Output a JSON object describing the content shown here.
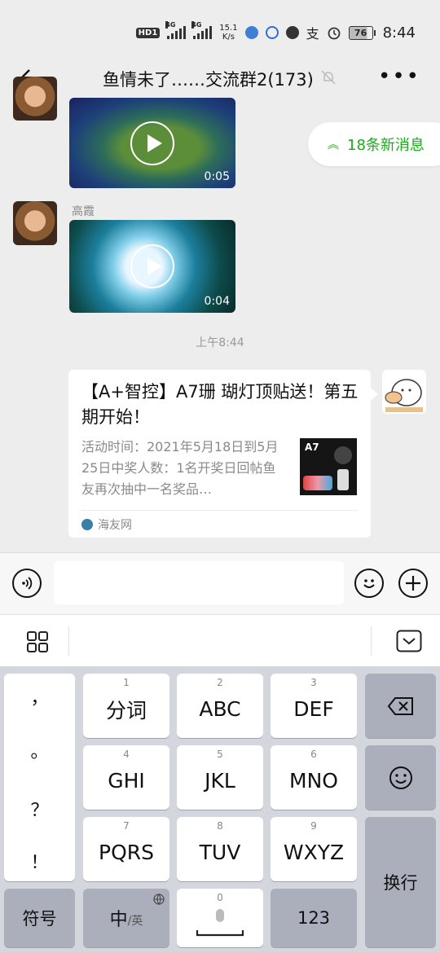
{
  "status_bar": {
    "hd": "HD",
    "hd_sub": "1",
    "network1": "4G",
    "network2": "4G",
    "speed_value": "15.1",
    "speed_unit": "K/s",
    "alipay_glyph": "支",
    "battery": "76",
    "time": "8:44"
  },
  "header": {
    "title": "鱼情未了……交流群2(173)",
    "more": "•••"
  },
  "messages": [
    {
      "type": "video",
      "duration": "0:05"
    },
    {
      "type": "video",
      "sender": "高霞",
      "duration": "0:04"
    }
  ],
  "new_messages": {
    "label": "18条新消息"
  },
  "timestamp": "上午8:44",
  "card": {
    "title": "【A+智控】A7珊 瑚灯顶贴送！第五期开始！",
    "description": "活动时间：2021年5月18日到5月25日中奖人数：1名开奖日回帖鱼友再次抽中一名奖品…",
    "thumb_label": "A7",
    "source": "海友网"
  },
  "keyboard": {
    "punct": [
      "，",
      "。",
      "？",
      "！"
    ],
    "keys": [
      {
        "num": "1",
        "label": "分词"
      },
      {
        "num": "2",
        "label": "ABC"
      },
      {
        "num": "3",
        "label": "DEF"
      },
      {
        "num": "4",
        "label": "GHI"
      },
      {
        "num": "5",
        "label": "JKL"
      },
      {
        "num": "6",
        "label": "MNO"
      },
      {
        "num": "7",
        "label": "PQRS"
      },
      {
        "num": "8",
        "label": "TUV"
      },
      {
        "num": "9",
        "label": "WXYZ"
      }
    ],
    "symbols": "符号",
    "lang_main": "中",
    "lang_alt": "/英",
    "space_num": "0",
    "numbers": "123",
    "enter": "换行"
  },
  "colors": {
    "accent_green": "#1aad19",
    "background": "#ededed",
    "keyboard_bg": "#d4d6dd"
  }
}
